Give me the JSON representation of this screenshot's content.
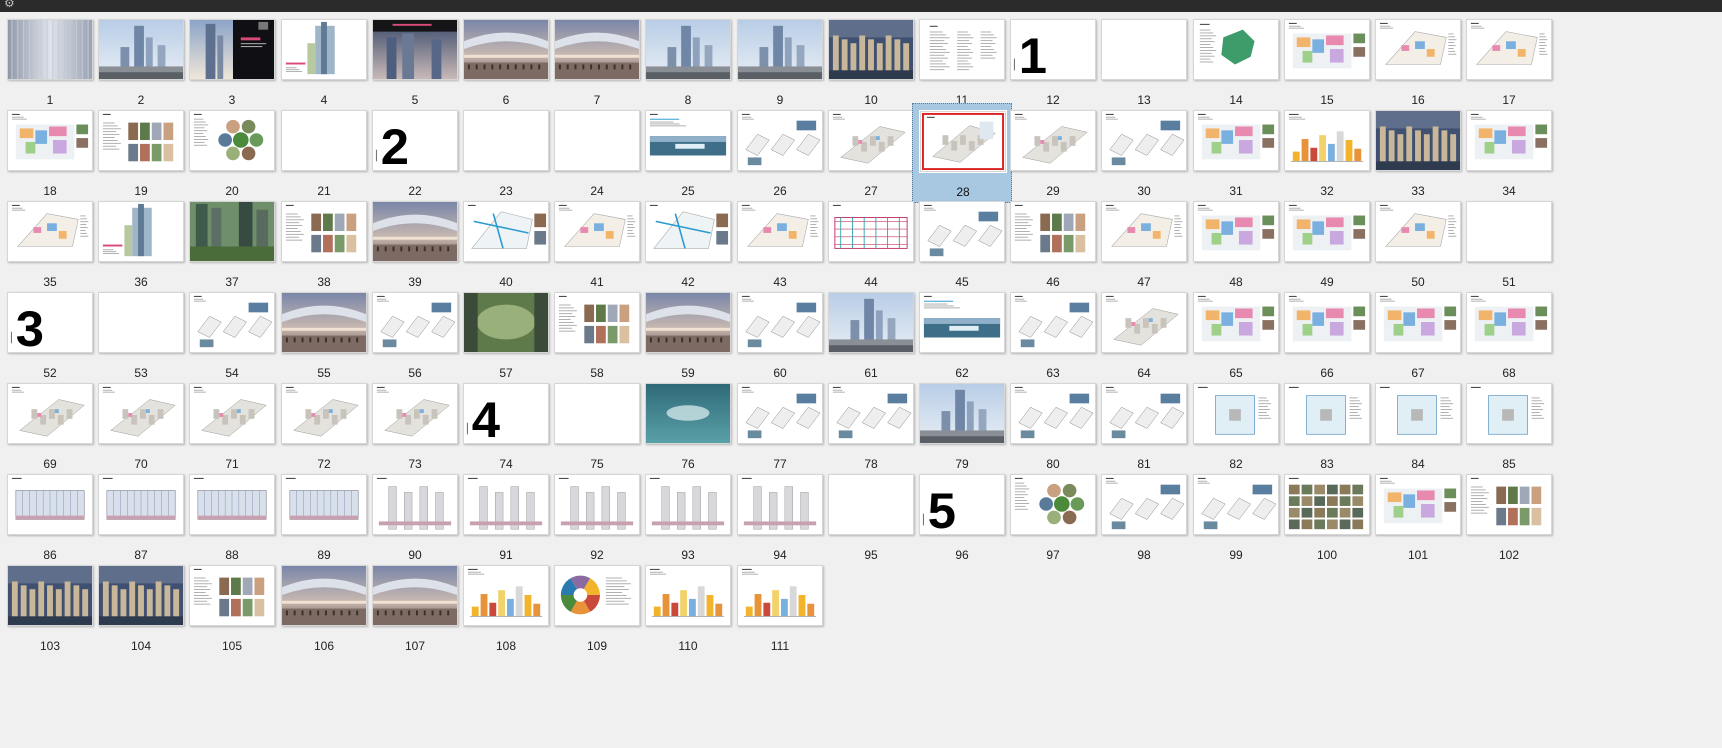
{
  "toolbar": {
    "icon": "gear-icon"
  },
  "selected_page": "28",
  "pages": [
    {
      "n": "1",
      "kind": "photo-silver"
    },
    {
      "n": "2",
      "kind": "photo-sky"
    },
    {
      "n": "3",
      "kind": "photo-dark-tower"
    },
    {
      "n": "4",
      "kind": "doc-tower"
    },
    {
      "n": "5",
      "kind": "photo-dark-banner"
    },
    {
      "n": "6",
      "kind": "photo-street"
    },
    {
      "n": "7",
      "kind": "photo-street"
    },
    {
      "n": "8",
      "kind": "photo-sky"
    },
    {
      "n": "9",
      "kind": "photo-sky"
    },
    {
      "n": "10",
      "kind": "photo-aerial"
    },
    {
      "n": "11",
      "kind": "doc-text"
    },
    {
      "n": "12",
      "kind": "section",
      "big": "1"
    },
    {
      "n": "13",
      "kind": "blank"
    },
    {
      "n": "14",
      "kind": "doc-map-green"
    },
    {
      "n": "15",
      "kind": "doc-map-color"
    },
    {
      "n": "16",
      "kind": "doc-plan"
    },
    {
      "n": "17",
      "kind": "doc-plan"
    },
    {
      "n": "18",
      "kind": "doc-map-color"
    },
    {
      "n": "19",
      "kind": "doc-collage"
    },
    {
      "n": "20",
      "kind": "doc-circles"
    },
    {
      "n": "21",
      "kind": "blank"
    },
    {
      "n": "22",
      "kind": "section",
      "big": "2"
    },
    {
      "n": "23",
      "kind": "blank"
    },
    {
      "n": "24",
      "kind": "blank"
    },
    {
      "n": "25",
      "kind": "doc-photo-strip"
    },
    {
      "n": "26",
      "kind": "doc-diagram"
    },
    {
      "n": "27",
      "kind": "doc-axon"
    },
    {
      "n": "28",
      "kind": "doc-axon-red"
    },
    {
      "n": "29",
      "kind": "doc-axon"
    },
    {
      "n": "30",
      "kind": "doc-diagram"
    },
    {
      "n": "31",
      "kind": "doc-map-color"
    },
    {
      "n": "32",
      "kind": "doc-chart"
    },
    {
      "n": "33",
      "kind": "photo-aerial"
    },
    {
      "n": "34",
      "kind": "doc-map-color"
    },
    {
      "n": "35",
      "kind": "doc-plan"
    },
    {
      "n": "36",
      "kind": "doc-tower"
    },
    {
      "n": "37",
      "kind": "photo-green-towers"
    },
    {
      "n": "38",
      "kind": "doc-collage"
    },
    {
      "n": "39",
      "kind": "photo-street"
    },
    {
      "n": "40",
      "kind": "doc-plan-blue"
    },
    {
      "n": "41",
      "kind": "doc-plan"
    },
    {
      "n": "42",
      "kind": "doc-plan-blue"
    },
    {
      "n": "43",
      "kind": "doc-plan"
    },
    {
      "n": "44",
      "kind": "doc-section-pink"
    },
    {
      "n": "45",
      "kind": "doc-diagram"
    },
    {
      "n": "46",
      "kind": "doc-collage"
    },
    {
      "n": "47",
      "kind": "doc-plan"
    },
    {
      "n": "48",
      "kind": "doc-map-color"
    },
    {
      "n": "49",
      "kind": "doc-map-color"
    },
    {
      "n": "50",
      "kind": "doc-plan"
    },
    {
      "n": "51",
      "kind": "blank"
    },
    {
      "n": "52",
      "kind": "section",
      "big": "3"
    },
    {
      "n": "53",
      "kind": "blank"
    },
    {
      "n": "54",
      "kind": "doc-diagram"
    },
    {
      "n": "55",
      "kind": "photo-street"
    },
    {
      "n": "56",
      "kind": "doc-diagram"
    },
    {
      "n": "57",
      "kind": "photo-green"
    },
    {
      "n": "58",
      "kind": "doc-collage"
    },
    {
      "n": "59",
      "kind": "photo-street"
    },
    {
      "n": "60",
      "kind": "doc-diagram"
    },
    {
      "n": "61",
      "kind": "photo-sky"
    },
    {
      "n": "62",
      "kind": "doc-photo-strip"
    },
    {
      "n": "63",
      "kind": "doc-diagram"
    },
    {
      "n": "64",
      "kind": "doc-axon"
    },
    {
      "n": "65",
      "kind": "doc-map-color"
    },
    {
      "n": "66",
      "kind": "doc-map-color"
    },
    {
      "n": "67",
      "kind": "doc-map-color"
    },
    {
      "n": "68",
      "kind": "doc-map-color"
    },
    {
      "n": "69",
      "kind": "doc-axon"
    },
    {
      "n": "70",
      "kind": "doc-axon"
    },
    {
      "n": "71",
      "kind": "doc-axon"
    },
    {
      "n": "72",
      "kind": "doc-axon"
    },
    {
      "n": "73",
      "kind": "doc-axon"
    },
    {
      "n": "74",
      "kind": "section",
      "big": "4"
    },
    {
      "n": "75",
      "kind": "blank"
    },
    {
      "n": "76",
      "kind": "photo-water"
    },
    {
      "n": "77",
      "kind": "doc-diagram"
    },
    {
      "n": "78",
      "kind": "doc-diagram"
    },
    {
      "n": "79",
      "kind": "photo-sky"
    },
    {
      "n": "80",
      "kind": "doc-diagram"
    },
    {
      "n": "81",
      "kind": "doc-diagram"
    },
    {
      "n": "82",
      "kind": "doc-floor"
    },
    {
      "n": "83",
      "kind": "doc-floor"
    },
    {
      "n": "84",
      "kind": "doc-floor"
    },
    {
      "n": "85",
      "kind": "doc-floor"
    },
    {
      "n": "86",
      "kind": "doc-elevation"
    },
    {
      "n": "87",
      "kind": "doc-elevation"
    },
    {
      "n": "88",
      "kind": "doc-elevation"
    },
    {
      "n": "89",
      "kind": "doc-elevation"
    },
    {
      "n": "90",
      "kind": "doc-section"
    },
    {
      "n": "91",
      "kind": "doc-section"
    },
    {
      "n": "92",
      "kind": "doc-section"
    },
    {
      "n": "93",
      "kind": "doc-section"
    },
    {
      "n": "94",
      "kind": "doc-section"
    },
    {
      "n": "95",
      "kind": "blank"
    },
    {
      "n": "96",
      "kind": "section",
      "big": "5"
    },
    {
      "n": "97",
      "kind": "doc-circles"
    },
    {
      "n": "98",
      "kind": "doc-diagram"
    },
    {
      "n": "99",
      "kind": "doc-diagram"
    },
    {
      "n": "100",
      "kind": "doc-grid-photos"
    },
    {
      "n": "101",
      "kind": "doc-map-color"
    },
    {
      "n": "102",
      "kind": "doc-collage"
    },
    {
      "n": "103",
      "kind": "photo-aerial"
    },
    {
      "n": "104",
      "kind": "photo-aerial"
    },
    {
      "n": "105",
      "kind": "doc-collage"
    },
    {
      "n": "106",
      "kind": "photo-street"
    },
    {
      "n": "107",
      "kind": "photo-street"
    },
    {
      "n": "108",
      "kind": "doc-chart"
    },
    {
      "n": "109",
      "kind": "doc-wheel"
    },
    {
      "n": "110",
      "kind": "doc-chart"
    },
    {
      "n": "111",
      "kind": "doc-chart"
    }
  ]
}
